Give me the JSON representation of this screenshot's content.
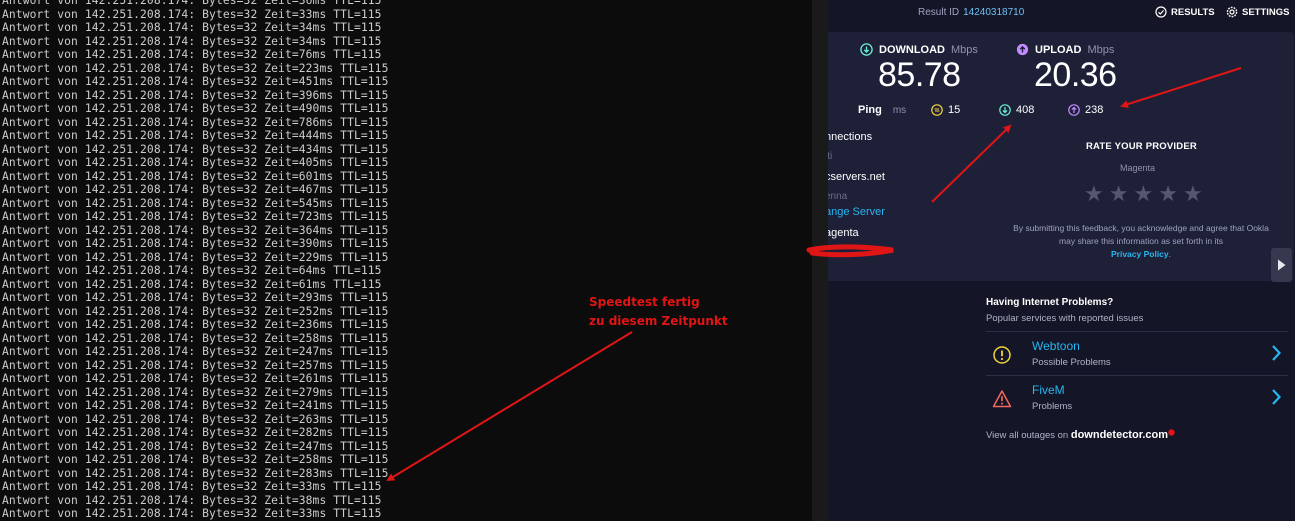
{
  "terminal": {
    "prefix": "Antwort von 142.251.208.174: Bytes=32 Zeit=",
    "suffix": " TTL=115",
    "times": [
      "36ms",
      "33ms",
      "34ms",
      "34ms",
      "76ms",
      "223ms",
      "451ms",
      "396ms",
      "490ms",
      "786ms",
      "444ms",
      "434ms",
      "405ms",
      "601ms",
      "467ms",
      "545ms",
      "723ms",
      "364ms",
      "390ms",
      "229ms",
      "64ms",
      "61ms",
      "293ms",
      "252ms",
      "236ms",
      "258ms",
      "247ms",
      "257ms",
      "261ms",
      "279ms",
      "241ms",
      "263ms",
      "282ms",
      "247ms",
      "258ms",
      "283ms",
      "33ms",
      "38ms",
      "33ms"
    ]
  },
  "annotation": {
    "line1": "Speedtest fertig",
    "line2": "zu diesem Zeitpunkt",
    "color": "#e01515"
  },
  "speedtest": {
    "result_id_label": "Result ID",
    "result_id": "14240318710",
    "results_label": "RESULTS",
    "settings_label": "SETTINGS",
    "download": {
      "label": "DOWNLOAD",
      "unit": "Mbps",
      "value": "85.78"
    },
    "upload": {
      "label": "UPLOAD",
      "unit": "Mbps",
      "value": "20.36"
    },
    "ping": {
      "label": "Ping",
      "unit": "ms",
      "idle": "15",
      "download": "408",
      "upload": "238"
    },
    "connections": "nnections",
    "connections_mode": "lti",
    "server_host": "cservers.net",
    "server_location": "enna",
    "change_server": "ange Server",
    "isp": "agenta",
    "rate_title": "RATE YOUR PROVIDER",
    "rate_provider": "Magenta",
    "stars": [
      "★",
      "★",
      "★",
      "★",
      "★"
    ],
    "disclaimer": "By submitting this feedback, you acknowledge and agree that Ookla may share this information as set forth in its",
    "privacy_link": "Privacy Policy",
    "colors": {
      "accent": "#28b6f0",
      "download": "#6bf0d8",
      "upload": "#c38bff",
      "ping": "#f3d33c"
    }
  },
  "problems": {
    "title": "Having Internet Problems?",
    "subtitle": "Popular services with reported issues",
    "items": [
      {
        "name": "Webtoon",
        "status": "Possible Problems",
        "icon": "info-warning-icon"
      },
      {
        "name": "FiveM",
        "status": "Problems",
        "icon": "alert-triangle-icon"
      }
    ],
    "outages_text": "View all outages on",
    "outages_site": "downdetector.com"
  }
}
